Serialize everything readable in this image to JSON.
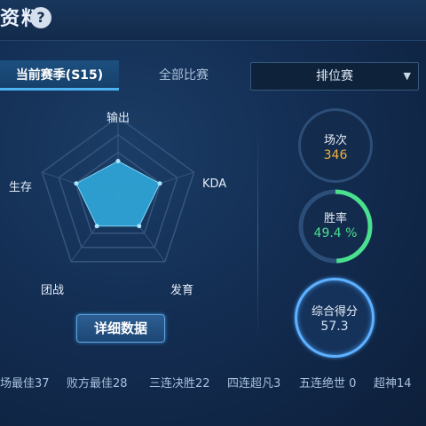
{
  "header": {
    "title": "资料",
    "help_label": "?"
  },
  "tabs": [
    {
      "label": "当前赛季(S15)",
      "active": true
    },
    {
      "label": "全部比赛",
      "active": false
    }
  ],
  "mode_select": {
    "value": "排位赛",
    "icon": "chevron-down-icon"
  },
  "radar": {
    "axes": [
      "输出",
      "KDA",
      "发育",
      "团战",
      "生存"
    ],
    "values_fraction": [
      0.45,
      0.55,
      0.45,
      0.45,
      0.55
    ],
    "fill_color": "#2fa6d8",
    "grid_color": "#35567d"
  },
  "detail_button": {
    "label": "详细数据"
  },
  "stats": {
    "games": {
      "label": "场次",
      "value": "346"
    },
    "winrate": {
      "label": "胜率",
      "value": "49.4 %",
      "fraction": 0.494,
      "color": "#49e08e"
    },
    "score": {
      "label": "综合得分",
      "value": "57.3"
    }
  },
  "achievements": [
    "场最佳37",
    "败方最佳28",
    "三连决胜22",
    "四连超凡3",
    "五连绝世 0",
    "超神14"
  ]
}
